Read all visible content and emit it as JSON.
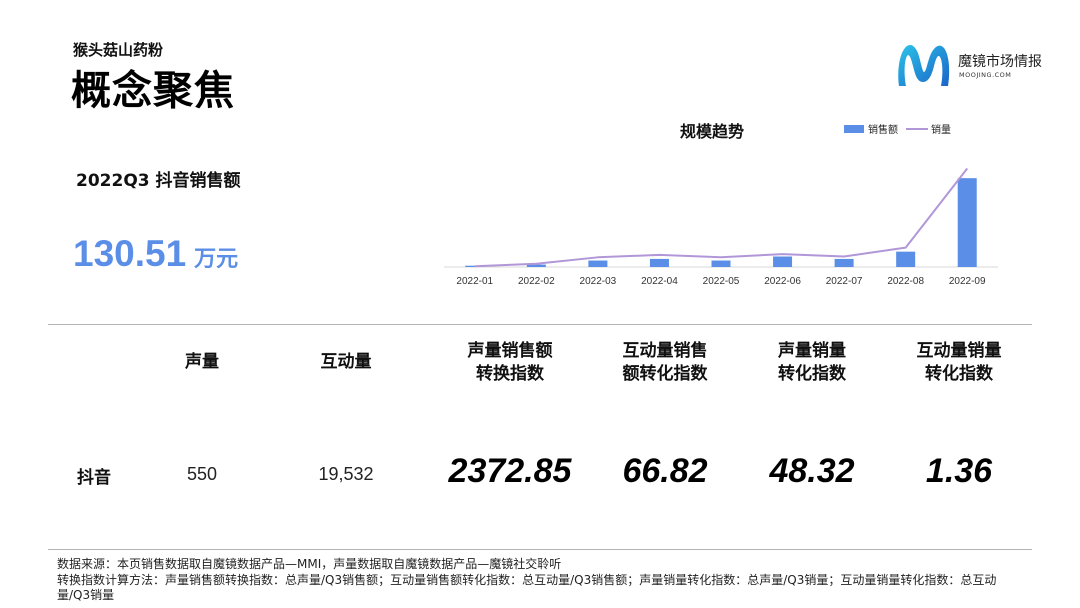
{
  "header": {
    "subtitle": "猴头菇山药粉",
    "title": "概念聚焦"
  },
  "logo": {
    "name_cn": "魔镜市场情报",
    "name_en": "MOOJING.COM",
    "colors": [
      "#22b3e0",
      "#1a6fd0"
    ]
  },
  "kpi": {
    "label": "2022Q3 抖音销售额",
    "value": "130.51",
    "unit": "万元",
    "color": "#5b8ee6"
  },
  "chart_data": {
    "type": "bar",
    "title": "规模趋势",
    "categories": [
      "2022-01",
      "2022-02",
      "2022-03",
      "2022-04",
      "2022-05",
      "2022-06",
      "2022-07",
      "2022-08",
      "2022-09"
    ],
    "series": [
      {
        "name": "销售额",
        "type": "bar",
        "color": "#5b8ee6",
        "values": [
          0.8,
          1.5,
          4.0,
          5.0,
          4.0,
          6.5,
          5.0,
          9.5,
          55.0
        ]
      },
      {
        "name": "销量",
        "type": "line",
        "color": "#b197d8",
        "values": [
          0.5,
          2.0,
          6.0,
          7.5,
          6.0,
          8.0,
          6.5,
          12.0,
          61.0
        ]
      }
    ],
    "ylim": [
      0,
      65
    ],
    "legend": "top-right",
    "grid": false,
    "colors": {
      "axis": "#d9d9d9",
      "tick_text": "#333333",
      "title": "#111111"
    }
  },
  "table": {
    "headers": [
      [
        "声量"
      ],
      [
        "互动量"
      ],
      [
        "声量销售额",
        "转换指数"
      ],
      [
        "互动量销售",
        "额转化指数"
      ],
      [
        "声量销量",
        "转化指数"
      ],
      [
        "互动量销量",
        "转化指数"
      ]
    ],
    "row": {
      "label": "抖音",
      "values": [
        "550",
        "19,532",
        "2372.85",
        "66.82",
        "48.32",
        "1.36"
      ]
    }
  },
  "footnote": {
    "line1": "数据来源：本页销售数据取自魔镜数据产品—MMI，声量数据取自魔镜数据产品—魔镜社交聆听",
    "line2": "转换指数计算方法：声量销售额转换指数：总声量/Q3销售额；互动量销售额转化指数：总互动量/Q3销售额；声量销量转化指数：总声量/Q3销量；互动量销量转化指数：总互动量/Q3销量"
  }
}
